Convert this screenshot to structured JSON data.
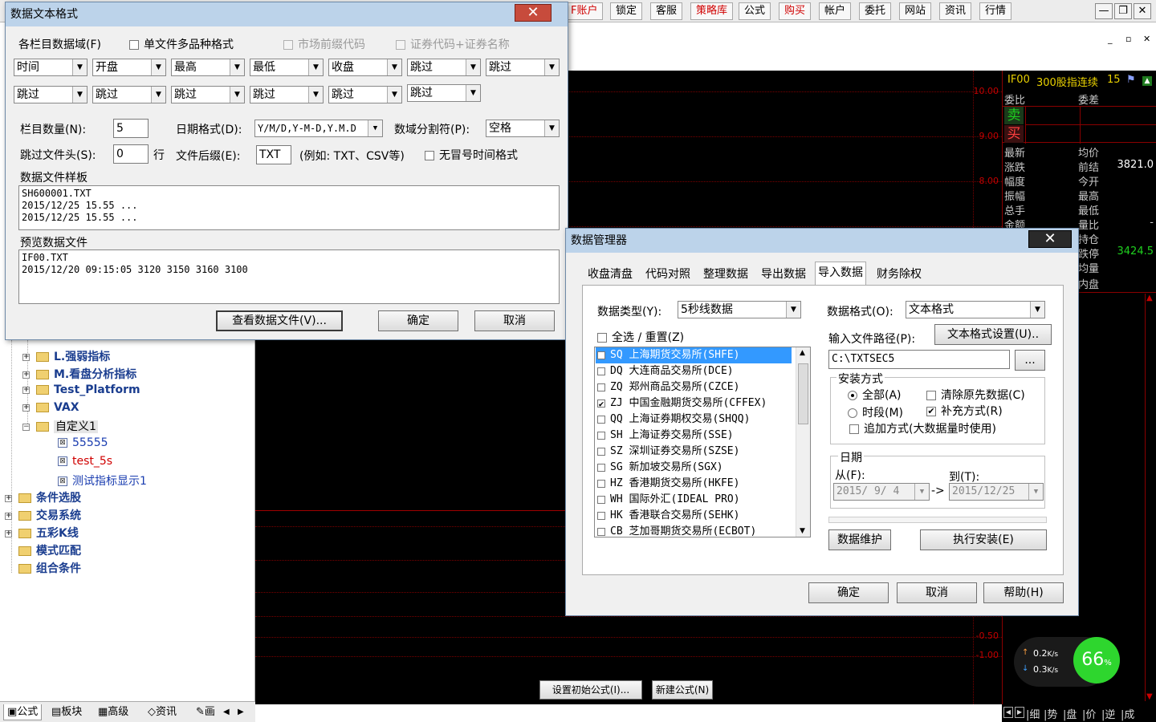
{
  "toolbar": {
    "buttons": [
      {
        "label": "F账户",
        "red": true
      },
      {
        "label": "锁定",
        "red": false
      },
      {
        "label": "客服",
        "red": false
      },
      {
        "label": "策略库",
        "red": true
      },
      {
        "label": "公式",
        "red": false
      },
      {
        "label": "购买",
        "red": true
      },
      {
        "label": "帐户",
        "red": false
      },
      {
        "label": "委托",
        "red": false
      },
      {
        "label": "网站",
        "red": false
      },
      {
        "label": "资讯",
        "red": false
      },
      {
        "label": "行情",
        "red": false
      }
    ],
    "minimize": "—",
    "maximize": "❐",
    "close": "✕"
  },
  "chart": {
    "y_labels": [
      "10.00",
      "9.00",
      "8.00",
      "-0.50",
      "-1.00"
    ]
  },
  "quote": {
    "code": "IF00",
    "name": "300股指连续",
    "period": "15",
    "weibi": "委比",
    "weicha": "委差",
    "sell": "卖",
    "buy": "买",
    "rows": [
      {
        "l": "最新",
        "m": "均价",
        "v": ""
      },
      {
        "l": "涨跌",
        "m": "前结",
        "v": "3821.0"
      },
      {
        "l": "幅度",
        "m": "今开",
        "v": ""
      },
      {
        "l": "振幅",
        "m": "最高",
        "v": ""
      },
      {
        "l": "总手",
        "m": "最低",
        "v": ""
      },
      {
        "l": "金额",
        "m": "量比",
        "v": "-"
      },
      {
        "l": "",
        "m": "持仓",
        "v": ""
      },
      {
        "l": "",
        "m": "跌停",
        "v": "3424.5"
      },
      {
        "l": "",
        "m": "均量",
        "v": ""
      },
      {
        "l": "",
        "m": "内盘",
        "v": ""
      }
    ],
    "bottom_tabs": [
      "细",
      "势",
      "盘",
      "价",
      "逆",
      "成"
    ]
  },
  "network": {
    "up": "0.2",
    "down": "0.3",
    "unit": "K/s",
    "percent": "66",
    "percent_sign": "%"
  },
  "tree": {
    "folders": [
      "L.强弱指标",
      "M.看盘分析指标",
      "Test_Platform",
      "VAX",
      "自定义1"
    ],
    "leaves": [
      {
        "label": "55555",
        "color": "#1a3db0"
      },
      {
        "label": "test_5s",
        "color": "#d00000"
      },
      {
        "label": "测试指标显示1",
        "color": "#1a3db0"
      }
    ],
    "root_folders": [
      "条件选股",
      "交易系统",
      "五彩K线",
      "模式匹配",
      "组合条件"
    ]
  },
  "left_tabs": [
    "公式",
    "板块",
    "高级",
    "资讯",
    "画"
  ],
  "bottom_buttons": {
    "set_initial": "设置初始公式(I)...",
    "new_formula": "新建公式(N)"
  },
  "text_dialog": {
    "title": "数据文本格式",
    "close": "✕",
    "fields_label": "各栏目数据域(F)",
    "single_file_multi": "单文件多品种格式",
    "market_prefix": "市场前缀代码",
    "code_name": "证券代码+证券名称",
    "row1": [
      "时间",
      "开盘",
      "最高",
      "最低",
      "收盘",
      "跳过",
      "跳过"
    ],
    "row2": [
      "跳过",
      "跳过",
      "跳过",
      "跳过",
      "跳过",
      "跳过"
    ],
    "count_label": "栏目数量(N):",
    "count_value": "5",
    "date_format_label": "日期格式(D):",
    "date_format_value": "Y/M/D,Y-M-D,Y.M.D",
    "separator_label": "数域分割符(P):",
    "separator_value": "空格",
    "skip_header_label": "跳过文件头(S):",
    "skip_header_value": "0",
    "skip_header_unit": "行",
    "suffix_label": "文件后缀(E):",
    "suffix_value": "TXT",
    "suffix_example": "(例如: TXT、CSV等)",
    "no_colon": "无冒号时间格式",
    "sample_label": "数据文件样板",
    "sample_text": "SH600001.TXT\n2015/12/25 15.55 ...\n2015/12/25 15.55 ...",
    "preview_label": "预览数据文件",
    "preview_text": "IF00.TXT\n2015/12/20 09:15:05 3120 3150 3160 3100",
    "view_button": "查看数据文件(V)...",
    "ok": "确定",
    "cancel": "取消"
  },
  "data_manager": {
    "title": "数据管理器",
    "close": "✕",
    "tabs": [
      "收盘清盘",
      "代码对照",
      "整理数据",
      "导出数据",
      "导入数据",
      "财务除权"
    ],
    "active_tab": 4,
    "data_type_label": "数据类型(Y):",
    "data_type_value": "5秒线数据",
    "select_all": "全选 / 重置(Z)",
    "exchanges": [
      {
        "code": "SQ",
        "name": "上海期货交易所(SHFE)",
        "checked": false,
        "selected": true
      },
      {
        "code": "DQ",
        "name": "大连商品交易所(DCE)",
        "checked": false,
        "selected": false
      },
      {
        "code": "ZQ",
        "name": "郑州商品交易所(CZCE)",
        "checked": false,
        "selected": false
      },
      {
        "code": "ZJ",
        "name": "中国金融期货交易所(CFFEX)",
        "checked": true,
        "selected": false
      },
      {
        "code": "QQ",
        "name": "上海证券期权交易(SHQQ)",
        "checked": false,
        "selected": false
      },
      {
        "code": "SH",
        "name": "上海证券交易所(SSE)",
        "checked": false,
        "selected": false
      },
      {
        "code": "SZ",
        "name": "深圳证券交易所(SZSE)",
        "checked": false,
        "selected": false
      },
      {
        "code": "SG",
        "name": "新加坡交易所(SGX)",
        "checked": false,
        "selected": false
      },
      {
        "code": "HZ",
        "name": "香港期货交易所(HKFE)",
        "checked": false,
        "selected": false
      },
      {
        "code": "WH",
        "name": "国际外汇(IDEAL PRO)",
        "checked": false,
        "selected": false
      },
      {
        "code": "HK",
        "name": "香港联合交易所(SEHK)",
        "checked": false,
        "selected": false
      },
      {
        "code": "CB",
        "name": "芝加哥期货交易所(ECBOT)",
        "checked": false,
        "selected": false
      }
    ],
    "format_label": "数据格式(O):",
    "format_value": "文本格式",
    "path_label": "输入文件路径(P):",
    "text_settings_button": "文本格式设置(U)..",
    "path_value": "C:\\TXTSEC5",
    "browse": "...",
    "install_group": "安装方式",
    "all": "全部(A)",
    "period": "时段(M)",
    "clear_prev": "清除原先数据(C)",
    "supplement": "补充方式(R)",
    "append": "追加方式(大数据量时使用)",
    "date_group": "日期",
    "from_label": "从(F):",
    "to_label": "到(T):",
    "from_value": "2015/ 9/ 4",
    "to_value": "2015/12/25",
    "arrow": "->",
    "maintain_button": "数据维护",
    "install_button": "执行安装(E)",
    "ok": "确定",
    "cancel": "取消",
    "help": "帮助(H)"
  }
}
